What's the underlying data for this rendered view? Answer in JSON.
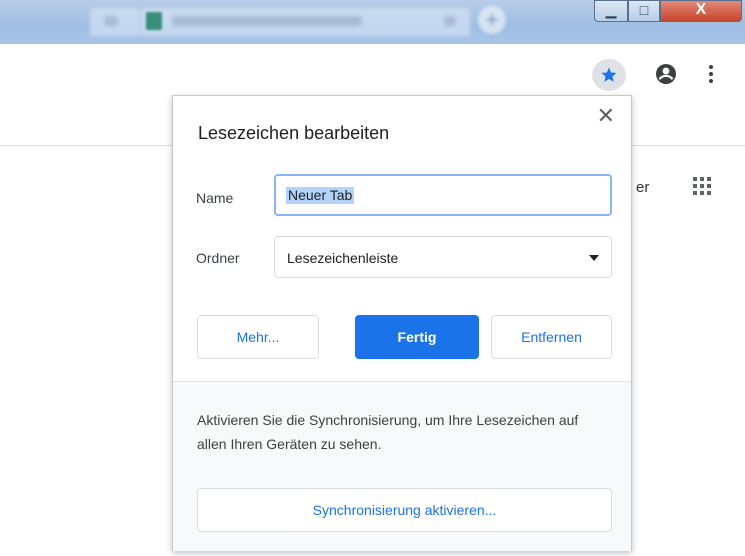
{
  "window": {
    "minimize_glyph": "▁",
    "maximize_glyph": "□",
    "close_glyph": "X",
    "new_tab_glyph": "+"
  },
  "toolbar": {
    "bookmark_icon": "star-icon",
    "account_icon": "account-circle-icon",
    "menu_icon": "more-vert-icon",
    "accent_color": "#1a73e8"
  },
  "page": {
    "partial_text": "er",
    "apps_icon": "apps-grid-icon"
  },
  "bubble": {
    "title": "Lesezeichen bearbeiten",
    "close_glyph": "✕",
    "name_label": "Name",
    "name_value": "Neuer Tab",
    "folder_label": "Ordner",
    "folder_value": "Lesezeichenleiste",
    "more_button": "Mehr...",
    "done_button": "Fertig",
    "remove_button": "Entfernen",
    "sync_text": "Aktivieren Sie die Synchronisierung, um Ihre Lesezeichen auf allen Ihren Geräten zu sehen.",
    "sync_button": "Synchronisierung aktivieren..."
  }
}
